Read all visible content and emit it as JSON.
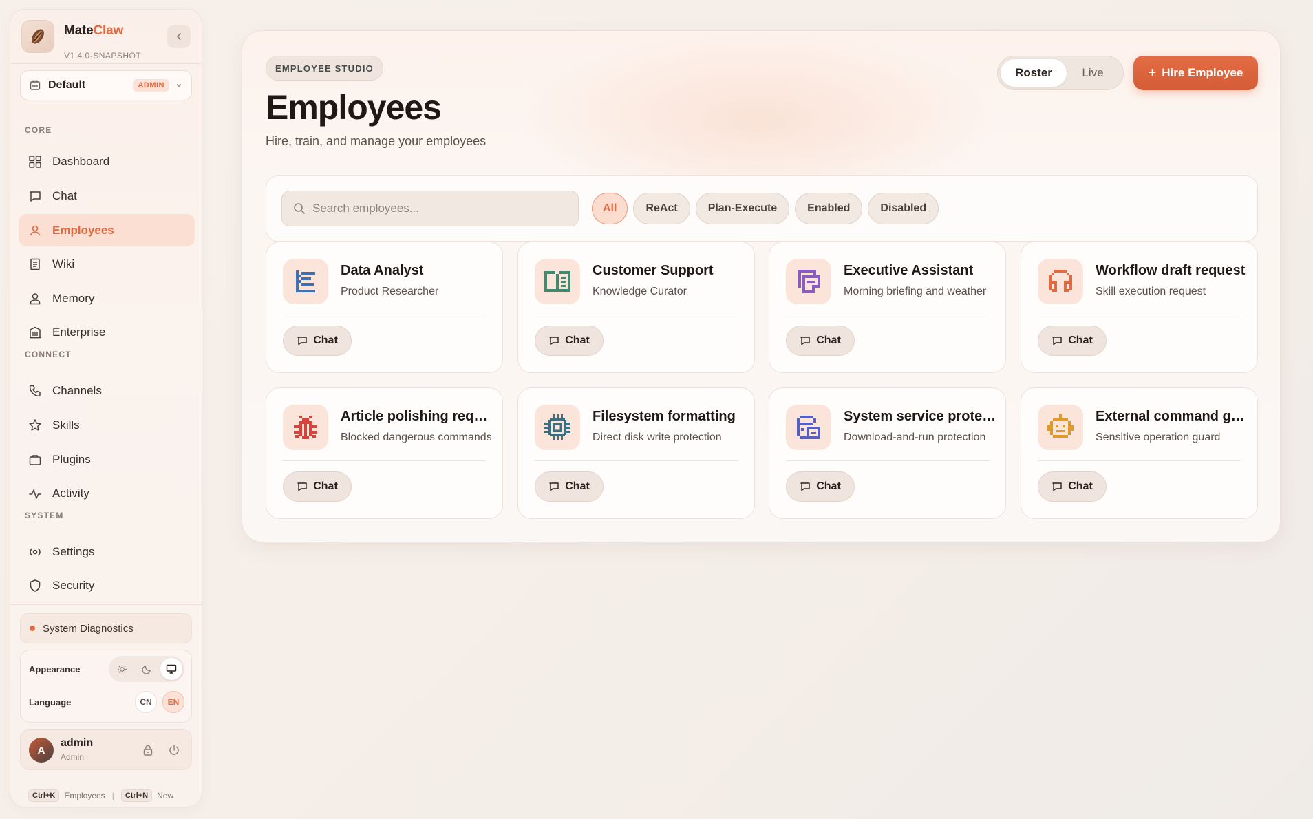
{
  "brand": {
    "name_part1": "Mate",
    "name_part2": "Claw",
    "version": "V1.4.0-SNAPSHOT"
  },
  "workspace": {
    "name": "Default",
    "badge": "ADMIN"
  },
  "sidebar": {
    "sections": [
      {
        "label": "CORE",
        "items": [
          {
            "label": "Dashboard",
            "icon": "dashboard-icon",
            "active": false
          },
          {
            "label": "Chat",
            "icon": "chat-icon",
            "active": false
          },
          {
            "label": "Employees",
            "icon": "user-icon",
            "active": true
          },
          {
            "label": "Wiki",
            "icon": "book-icon",
            "active": false
          },
          {
            "label": "Memory",
            "icon": "person-icon",
            "active": false
          },
          {
            "label": "Enterprise",
            "icon": "building-icon",
            "active": false
          }
        ]
      },
      {
        "label": "CONNECT",
        "items": [
          {
            "label": "Channels",
            "icon": "phone-icon",
            "active": false
          },
          {
            "label": "Skills",
            "icon": "star-icon",
            "active": false
          },
          {
            "label": "Plugins",
            "icon": "briefcase-icon",
            "active": false
          },
          {
            "label": "Activity",
            "icon": "activity-icon",
            "active": false
          }
        ]
      },
      {
        "label": "SYSTEM",
        "items": [
          {
            "label": "Settings",
            "icon": "settings-icon",
            "active": false
          },
          {
            "label": "Security",
            "icon": "shield-icon",
            "active": false
          }
        ]
      }
    ],
    "diagnostics": "System Diagnostics",
    "appearance_label": "Appearance",
    "language_label": "Language",
    "lang_cn": "CN",
    "lang_en": "EN",
    "user": {
      "initial": "A",
      "name": "admin",
      "role": "Admin"
    },
    "shortcuts": [
      {
        "key": "Ctrl+K",
        "label": "Employees"
      },
      {
        "key": "Ctrl+N",
        "label": "New"
      }
    ]
  },
  "header": {
    "eyebrow": "EMPLOYEE STUDIO",
    "title": "Employees",
    "subtitle": "Hire, train, and manage your employees",
    "toggle": [
      "Roster",
      "Live"
    ],
    "hire_label": "Hire Employee"
  },
  "search": {
    "placeholder": "Search employees..."
  },
  "filters": [
    "All",
    "ReAct",
    "Plan-Execute",
    "Enabled",
    "Disabled"
  ],
  "employees": [
    {
      "name": "Data Analyst",
      "desc": "Product Researcher",
      "icon": "document-list-icon",
      "color": "#3f6fb5"
    },
    {
      "name": "Customer Support",
      "desc": "Knowledge Curator",
      "icon": "open-book-icon",
      "color": "#3f8a70"
    },
    {
      "name": "Executive Assistant",
      "desc": "Morning briefing and weather",
      "icon": "clipboard-icon",
      "color": "#8a5bc0"
    },
    {
      "name": "Workflow draft request",
      "desc": "Skill execution request",
      "icon": "headphones-icon",
      "color": "#e06a43"
    },
    {
      "name": "Article polishing request",
      "desc": "Blocked dangerous commands",
      "icon": "bug-icon",
      "color": "#d9443a"
    },
    {
      "name": "Filesystem formatting",
      "desc": "Direct disk write protection",
      "icon": "cpu-icon",
      "color": "#3d6f80"
    },
    {
      "name": "System service protection",
      "desc": "Download-and-run protection",
      "icon": "database-icon",
      "color": "#5560c0"
    },
    {
      "name": "External command guard",
      "desc": "Sensitive operation guard",
      "icon": "robot-icon",
      "color": "#e09a2a"
    }
  ],
  "chat_label": "Chat"
}
